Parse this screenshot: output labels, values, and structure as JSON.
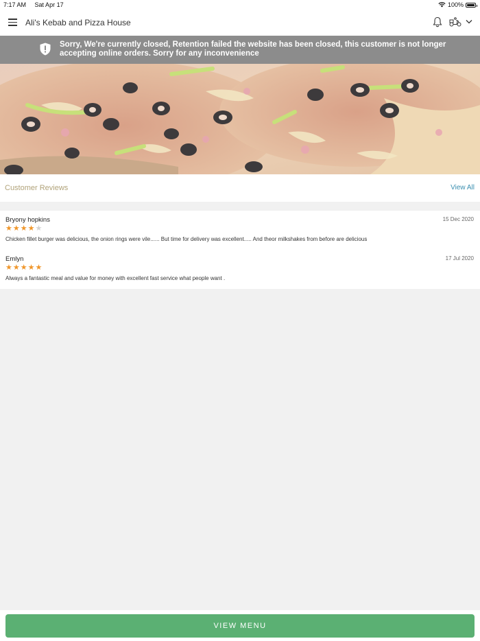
{
  "status_bar": {
    "time": "7:17 AM",
    "date": "Sat Apr 17",
    "battery": "100%"
  },
  "header": {
    "title": "Ali's Kebab and Pizza House"
  },
  "banner": {
    "message": "Sorry, We're currently closed, Retention failed the website has been closed, this customer is not longer accepting online orders. Sorry for any inconvenience"
  },
  "reviews": {
    "title": "Customer Reviews",
    "view_all": "View All",
    "items": [
      {
        "author": "Bryony hopkins",
        "date": "15 Dec 2020",
        "rating": 4,
        "text": "Chicken fillet burger was delicious, the onion rings were vile...... But time for delivery was excellent..... And theor milkshakes from before are delicious"
      },
      {
        "author": "Emlyn",
        "date": "17 Jul 2020",
        "rating": 5,
        "text": "Always a fantastic meal and value for money with excellent fast service what people want ."
      }
    ]
  },
  "footer": {
    "view_menu": "VIEW MENU"
  },
  "colors": {
    "accent": "#5bb073",
    "banner": "#8c8c8c",
    "star": "#f0962a",
    "link": "#3a8fb0",
    "section_title": "#b1a37a"
  }
}
